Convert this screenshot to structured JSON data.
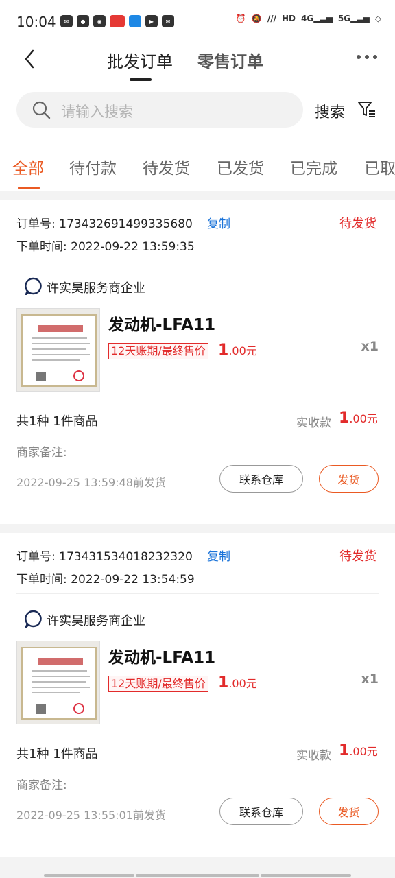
{
  "status_bar": {
    "time": "10:04",
    "icons": [
      "mail-icon",
      "chat-icon",
      "app-icon",
      "red-app-icon",
      "blue-app-icon",
      "play-icon",
      "mail-icon"
    ],
    "right_icons": [
      "alarm-icon",
      "mute-icon",
      "signal-icon",
      "hd-icon",
      "4g-icon",
      "5g-icon",
      "wifi-icon"
    ],
    "network_4g": "4G",
    "network_5g": "5G",
    "hd": "HD"
  },
  "header": {
    "tab_wholesale": "批发订单",
    "tab_retail": "零售订单"
  },
  "search": {
    "placeholder": "请输入搜索",
    "button": "搜索"
  },
  "status_tabs": [
    "全部",
    "待付款",
    "待发货",
    "已发货",
    "已完成",
    "已取"
  ],
  "orders": [
    {
      "order_no_label": "订单号:",
      "order_no": "173432691499335680",
      "copy": "复制",
      "status": "待发货",
      "time_label": "下单时间:",
      "time": "2022-09-22 13:59:35",
      "store": "许实昊服务商企业",
      "product_title": "发动机-LFA11",
      "tag": "12天账期/最终售价",
      "price_int": "1",
      "price_dec": ".00元",
      "qty": "x1",
      "count": "共1种 1件商品",
      "paid_label": "实收款",
      "paid_int": "1",
      "paid_dec": ".00元",
      "note_label": "商家备注:",
      "deadline": "2022-09-25 13:59:48前发货",
      "contact_btn": "联系仓库",
      "ship_btn": "发货"
    },
    {
      "order_no_label": "订单号:",
      "order_no": "173431534018232320",
      "copy": "复制",
      "status": "待发货",
      "time_label": "下单时间:",
      "time": "2022-09-22 13:54:59",
      "store": "许实昊服务商企业",
      "product_title": "发动机-LFA11",
      "tag": "12天账期/最终售价",
      "price_int": "1",
      "price_dec": ".00元",
      "qty": "x1",
      "count": "共1种 1件商品",
      "paid_label": "实收款",
      "paid_int": "1",
      "paid_dec": ".00元",
      "note_label": "商家备注:",
      "deadline": "2022-09-25 13:55:01前发货",
      "contact_btn": "联系仓库",
      "ship_btn": "发货"
    }
  ],
  "colors": {
    "accent": "#ea5a23",
    "price_red": "#e22b2b",
    "link_blue": "#1a73d9"
  }
}
